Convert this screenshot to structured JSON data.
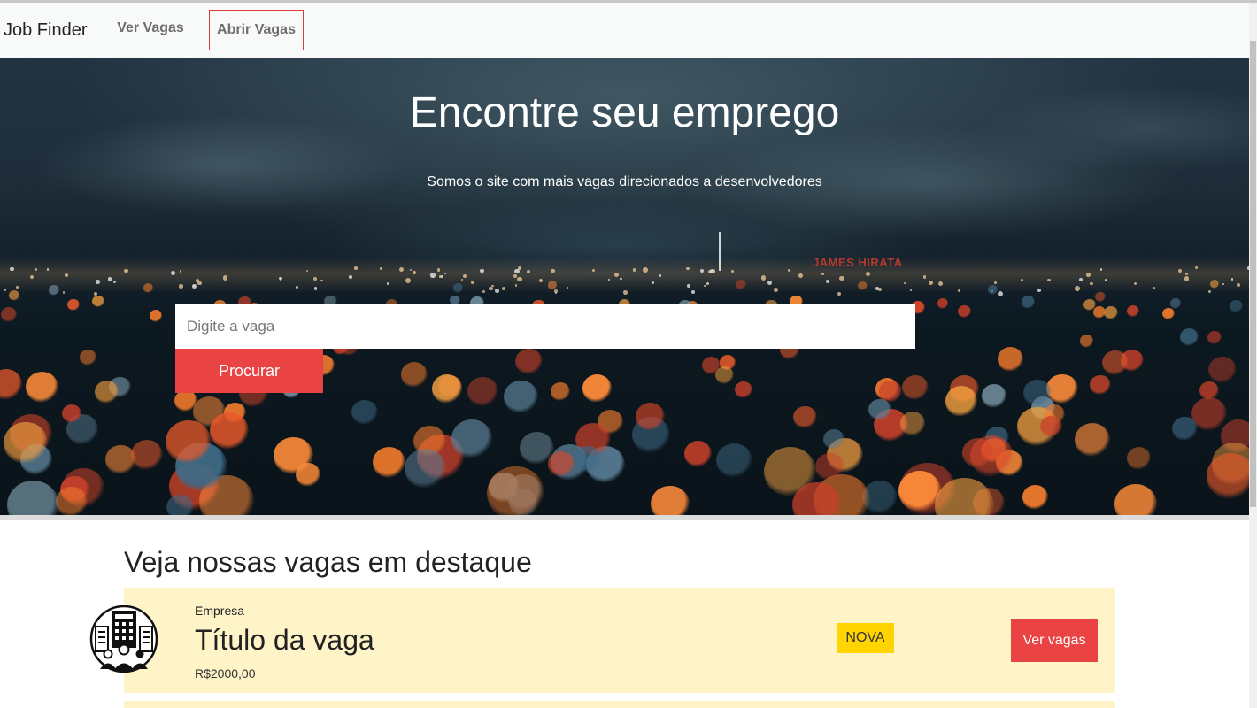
{
  "navbar": {
    "brand": "Job Finder",
    "links": [
      {
        "label": "Ver Vagas"
      },
      {
        "label": "Abrir Vagas"
      }
    ]
  },
  "hero": {
    "title": "Encontre seu emprego",
    "subtitle": "Somos o site com mais vagas direcionados a desenvolvedores",
    "watermark": "JAMES HIRATA",
    "search": {
      "placeholder": "Digite a vaga",
      "value": "",
      "button_label": "Procurar"
    }
  },
  "featured": {
    "title": "Veja nossas vagas em destaque",
    "jobs": [
      {
        "company": "Empresa",
        "title": "Título da vaga",
        "salary": "R$2000,00",
        "badge": "NOVA",
        "button_label": "Ver vagas",
        "logo_icon": "office-building-people-icon"
      }
    ]
  },
  "colors": {
    "accent_red": "#e94343",
    "badge_yellow": "#ffd400",
    "card_background": "#fff3c8",
    "navbar_background": "#f8f9f9"
  }
}
